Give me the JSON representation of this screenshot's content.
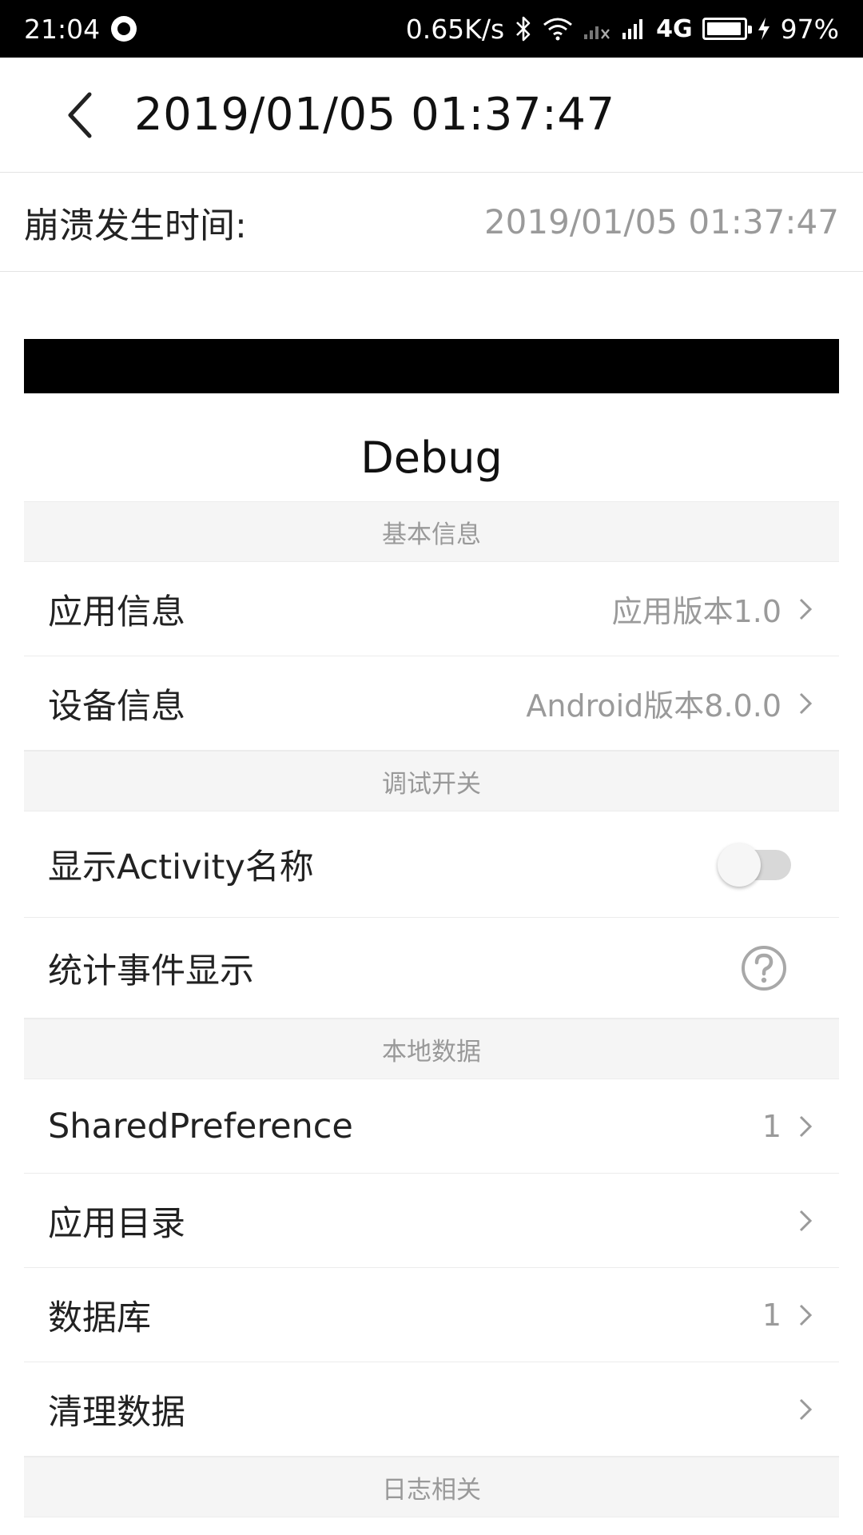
{
  "status_bar": {
    "time": "21:04",
    "network_speed": "0.65K/s",
    "network_type": "4G",
    "battery_percent": "97%",
    "battery_level": 0.97,
    "icons": [
      "recording-icon",
      "bluetooth-icon",
      "wifi-icon",
      "signal-muted-icon",
      "signal-icon",
      "battery-icon",
      "charging-icon"
    ]
  },
  "header": {
    "title": "2019/01/05 01:37:47",
    "back_icon": "chevron-left-icon"
  },
  "crash_info": {
    "label": "崩溃发生时间:",
    "value": "2019/01/05 01:37:47"
  },
  "debug_title": "Debug",
  "sections": {
    "basic": {
      "header": "基本信息",
      "app_info": {
        "label": "应用信息",
        "value": "应用版本1.0"
      },
      "device_info": {
        "label": "设备信息",
        "value": "Android版本8.0.0"
      }
    },
    "switches": {
      "header": "调试开关",
      "show_activity": {
        "label": "显示Activity名称",
        "enabled": false
      },
      "stat_events": {
        "label": "统计事件显示",
        "icon": "help-circle-icon"
      }
    },
    "local_data": {
      "header": "本地数据",
      "shared_pref": {
        "label": "SharedPreference",
        "value": "1"
      },
      "app_dir": {
        "label": "应用目录",
        "value": ""
      },
      "database": {
        "label": "数据库",
        "value": "1"
      },
      "clear_data": {
        "label": "清理数据",
        "value": ""
      }
    },
    "logs": {
      "header": "日志相关"
    }
  },
  "colors": {
    "status_bar_bg": "#000000",
    "section_bg": "#f5f5f5",
    "secondary_text": "#9a9a9a",
    "divider": "#ececec"
  }
}
